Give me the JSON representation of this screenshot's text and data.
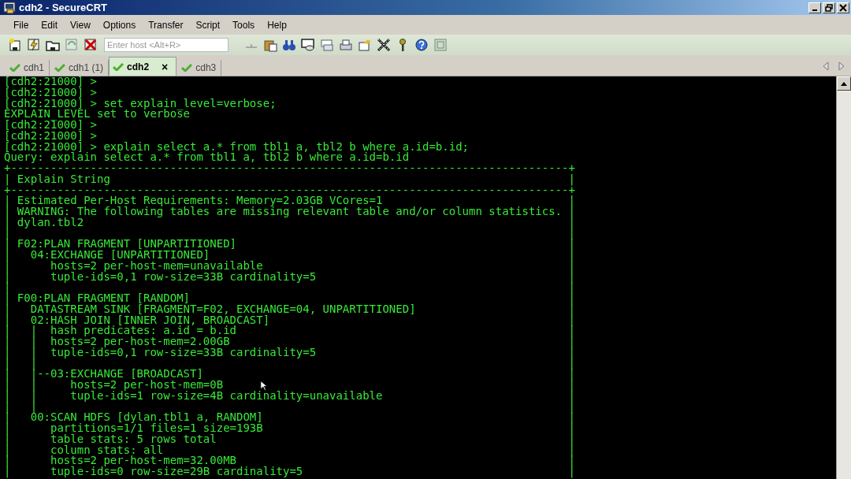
{
  "window": {
    "title": "cdh2 - SecureCRT"
  },
  "menu": [
    "File",
    "Edit",
    "View",
    "Options",
    "Transfer",
    "Script",
    "Tools",
    "Help"
  ],
  "toolbar": {
    "host_field": {
      "placeholder": "Enter host <Alt+R>"
    }
  },
  "tabs": [
    {
      "label": "cdh1",
      "selected": false
    },
    {
      "label": "cdh1 (1)",
      "selected": false
    },
    {
      "label": "cdh2",
      "selected": true,
      "close": "×"
    },
    {
      "label": "cdh3",
      "selected": false
    }
  ],
  "terminal": {
    "lines": [
      {
        "kind": "plain",
        "text": "[cdh2:21000] >"
      },
      {
        "kind": "plain",
        "text": "[cdh2:21000] >"
      },
      {
        "kind": "plain",
        "text": "[cdh2:21000] > set explain_level=verbose;"
      },
      {
        "kind": "plain",
        "text": "EXPLAIN_LEVEL set to verbose"
      },
      {
        "kind": "plain",
        "text": "[cdh2:21000] >"
      },
      {
        "kind": "plain",
        "text": "[cdh2:21000] >"
      },
      {
        "kind": "plain",
        "text": "[cdh2:21000] > explain select a.* from tbl1 a, tbl2 b where a.id=b.id;"
      },
      {
        "kind": "plain",
        "text": "Query: explain select a.* from tbl1 a, tbl2 b where a.id=b.id"
      },
      {
        "kind": "plain",
        "text": "+------------------------------------------------------------------------------------+"
      },
      {
        "kind": "boxed",
        "left": "|",
        "text": " Explain String",
        "right": "|"
      },
      {
        "kind": "plain",
        "text": "+------------------------------------------------------------------------------------+"
      },
      {
        "kind": "boxed",
        "left": "|",
        "text": " Estimated Per-Host Requirements: Memory=2.03GB VCores=1",
        "right": "|"
      },
      {
        "kind": "boxed",
        "left": "|",
        "text": " WARNING: The following tables are missing relevant table and/or column statistics.",
        "right": "|"
      },
      {
        "kind": "boxed",
        "left": "|",
        "text": " dylan.tbl2",
        "right": "|"
      },
      {
        "kind": "boxed",
        "left": "|",
        "right": "|"
      },
      {
        "kind": "boxed",
        "left": "|",
        "text": " F02:PLAN FRAGMENT [UNPARTITIONED]",
        "right": "|"
      },
      {
        "kind": "boxed",
        "left": "|",
        "text": "   04:EXCHANGE [UNPARTITIONED]",
        "right": "|"
      },
      {
        "kind": "boxed",
        "left": "|",
        "text": "      hosts=2 per-host-mem=unavailable",
        "right": "|"
      },
      {
        "kind": "boxed",
        "left": "|",
        "text": "      tuple-ids=0,1 row-size=33B cardinality=5",
        "right": "|"
      },
      {
        "kind": "boxed",
        "left": "|",
        "right": "|"
      },
      {
        "kind": "boxed",
        "left": "|",
        "text": " F00:PLAN FRAGMENT [RANDOM]",
        "right": "|"
      },
      {
        "kind": "boxed",
        "left": "|",
        "text": "   DATASTREAM SINK [FRAGMENT=F02, EXCHANGE=04, UNPARTITIONED]",
        "right": "|"
      },
      {
        "kind": "boxed",
        "left": "|",
        "text": "   02:HASH JOIN [INNER JOIN, BROADCAST]",
        "right": "|"
      },
      {
        "kind": "boxed",
        "left": "|",
        "text": "   |  hash predicates: a.id = b.id",
        "right": "|"
      },
      {
        "kind": "boxed",
        "left": "|",
        "text": "   |  hosts=2 per-host-mem=2.00GB",
        "right": "|"
      },
      {
        "kind": "boxed",
        "left": "|",
        "text": "   |  tuple-ids=0,1 row-size=33B cardinality=5",
        "right": "|"
      },
      {
        "kind": "boxed",
        "left": "|",
        "text": "   |",
        "right": "|"
      },
      {
        "kind": "boxed",
        "left": "|",
        "text": "   |--03:EXCHANGE [BROADCAST]",
        "right": "|"
      },
      {
        "kind": "boxed",
        "left": "|",
        "text": "   |     hosts=2 per-host-mem=0B",
        "right": "|"
      },
      {
        "kind": "boxed",
        "left": "|",
        "text": "   |     tuple-ids=1 row-size=4B cardinality=unavailable",
        "right": "|"
      },
      {
        "kind": "boxed",
        "left": "|",
        "text": "   |",
        "right": "|"
      },
      {
        "kind": "boxed",
        "left": "|",
        "text": "   00:SCAN HDFS [dylan.tbl1 a, RANDOM]",
        "right": "|"
      },
      {
        "kind": "boxed",
        "left": "|",
        "text": "      partitions=1/1 files=1 size=193B",
        "right": "|"
      },
      {
        "kind": "boxed",
        "left": "|",
        "text": "      table stats: 5 rows total",
        "right": "|"
      },
      {
        "kind": "boxed",
        "left": "|",
        "text": "      column stats: all",
        "right": "|"
      },
      {
        "kind": "boxed",
        "left": "|",
        "text": "      hosts=2 per-host-mem=32.00MB",
        "right": "|"
      },
      {
        "kind": "boxed",
        "left": "|",
        "text": "      tuple-ids=0 row-size=29B cardinality=5",
        "right": "|"
      }
    ]
  }
}
